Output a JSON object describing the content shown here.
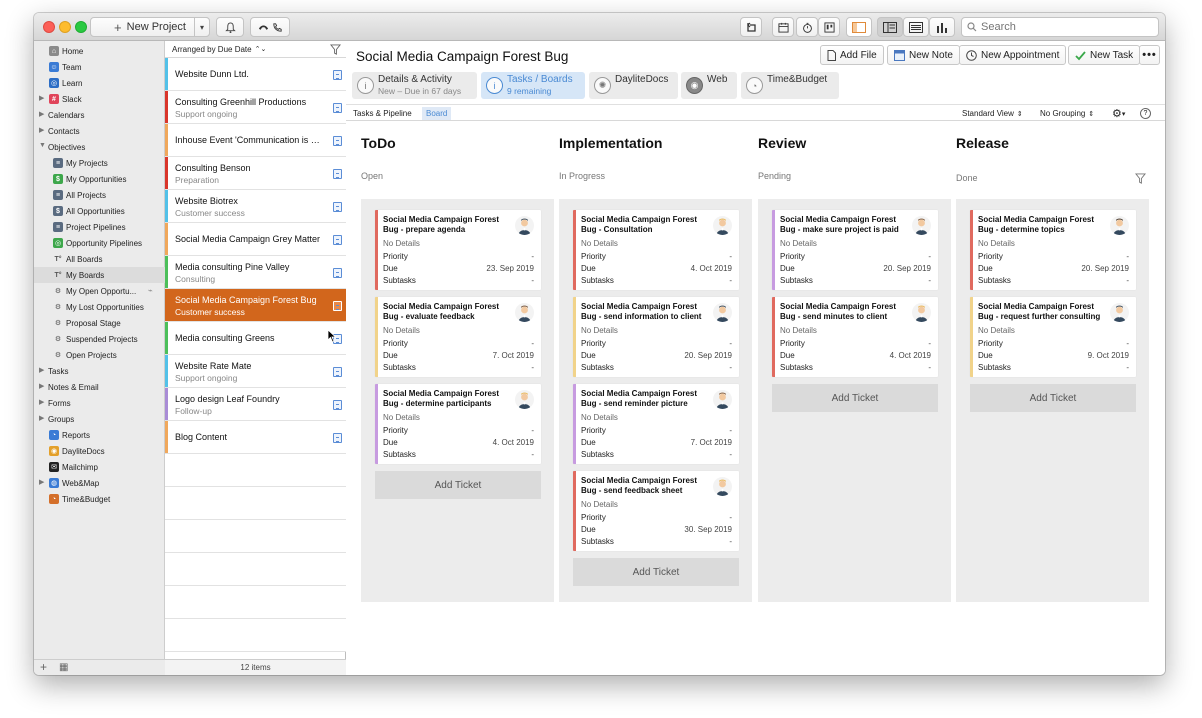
{
  "toolbar": {
    "new_project": "New Project",
    "search_placeholder": "Search"
  },
  "sidebar": {
    "items": [
      {
        "label": "Home"
      },
      {
        "label": "Team"
      },
      {
        "label": "Learn"
      },
      {
        "label": "Slack"
      },
      {
        "label": "Calendars"
      },
      {
        "label": "Contacts"
      },
      {
        "label": "Objectives"
      },
      {
        "label": "My Projects"
      },
      {
        "label": "My Opportunities"
      },
      {
        "label": "All Projects"
      },
      {
        "label": "All Opportunities"
      },
      {
        "label": "Project Pipelines"
      },
      {
        "label": "Opportunity Pipelines"
      },
      {
        "label": "All Boards"
      },
      {
        "label": "My Boards"
      },
      {
        "label": "My Open Opportu..."
      },
      {
        "label": "My Lost Opportunities"
      },
      {
        "label": "Proposal Stage"
      },
      {
        "label": "Suspended Projects"
      },
      {
        "label": "Open Projects"
      },
      {
        "label": "Tasks"
      },
      {
        "label": "Notes & Email"
      },
      {
        "label": "Forms"
      },
      {
        "label": "Groups"
      },
      {
        "label": "Reports"
      },
      {
        "label": "DayliteDocs"
      },
      {
        "label": "Mailchimp"
      },
      {
        "label": "Web&Map"
      },
      {
        "label": "Time&Budget"
      }
    ]
  },
  "list": {
    "header": "Arranged by Due Date",
    "footer": "12 items",
    "rows": [
      {
        "title": "Website Dunn Ltd.",
        "subtitle": "",
        "color": "#53c1e8"
      },
      {
        "title": "Consulting Greenhill Productions",
        "subtitle": "Support ongoing",
        "color": "#d9362b"
      },
      {
        "title": "Inhouse Event 'Communication is e...",
        "subtitle": "",
        "color": "#f0a85c"
      },
      {
        "title": "Consulting Benson",
        "subtitle": "Preparation",
        "color": "#d9362b"
      },
      {
        "title": "Website Biotrex",
        "subtitle": "Customer success",
        "color": "#53c1e8"
      },
      {
        "title": "Social Media Campaign Grey Matter",
        "subtitle": "",
        "color": "#f0a85c"
      },
      {
        "title": "Media consulting Pine Valley",
        "subtitle": "Consulting",
        "color": "#4cbf5a"
      },
      {
        "title": "Social Media Campaign Forest Bug",
        "subtitle": "Customer success",
        "color": "#d2661c"
      },
      {
        "title": "Media consulting Greens",
        "subtitle": "",
        "color": "#4cbf5a"
      },
      {
        "title": "Website Rate Mate",
        "subtitle": "Support ongoing",
        "color": "#53c1e8"
      },
      {
        "title": "Logo design Leaf Foundry",
        "subtitle": "Follow-up",
        "color": "#a98cd6"
      },
      {
        "title": "Blog Content",
        "subtitle": "",
        "color": "#f0a85c"
      }
    ]
  },
  "main": {
    "title": "Social Media Campaign Forest Bug",
    "actions": {
      "add_file": "Add File",
      "new_note": "New Note",
      "new_appointment": "New Appointment",
      "new_task": "New Task"
    },
    "tabs": [
      {
        "label": "Details & Activity",
        "sub": "New – Due in 67 days"
      },
      {
        "label": "Tasks / Boards",
        "sub": "9 remaining"
      },
      {
        "label": "DayliteDocs",
        "sub": ""
      },
      {
        "label": "Web",
        "sub": ""
      },
      {
        "label": "Time&Budget",
        "sub": ""
      }
    ],
    "subtabs": {
      "pipeline": "Tasks & Pipeline",
      "board": "Board"
    },
    "view": "Standard View",
    "grouping": "No Grouping",
    "help": "?"
  },
  "board": {
    "labels": {
      "no_details": "No Details",
      "priority": "Priority",
      "due": "Due",
      "subtasks": "Subtasks",
      "dash": "-",
      "add_ticket": "Add Ticket"
    },
    "columns": [
      {
        "title": "ToDo",
        "status": "Open",
        "cards": [
          {
            "title": "Social Media Campaign Forest Bug - prepare agenda",
            "due": "23. Sep 2019",
            "color": "#e06a5f"
          },
          {
            "title": "Social Media Campaign Forest Bug - evaluate feedback",
            "due": "7. Oct 2019",
            "color": "#f1d38a"
          },
          {
            "title": "Social Media Campaign Forest Bug - determine participants",
            "due": "4. Oct 2019",
            "color": "#c79be0"
          }
        ]
      },
      {
        "title": "Implementation",
        "status": "In Progress",
        "cards": [
          {
            "title": "Social Media Campaign Forest Bug - Consultation",
            "due": "4. Oct 2019",
            "color": "#e06a5f"
          },
          {
            "title": "Social Media Campaign Forest Bug - send information to client",
            "due": "20. Sep 2019",
            "color": "#f1d38a"
          },
          {
            "title": "Social Media Campaign Forest Bug - send reminder picture",
            "due": "7. Oct 2019",
            "color": "#c79be0"
          },
          {
            "title": "Social Media Campaign Forest Bug - send feedback sheet",
            "due": "30. Sep 2019",
            "color": "#e06a5f"
          }
        ]
      },
      {
        "title": "Review",
        "status": "Pending",
        "cards": [
          {
            "title": "Social Media Campaign Forest Bug - make sure project is paid",
            "due": "20. Sep 2019",
            "color": "#c79be0"
          },
          {
            "title": "Social Media Campaign Forest Bug - send minutes to client",
            "due": "4. Oct 2019",
            "color": "#e06a5f"
          }
        ]
      },
      {
        "title": "Release",
        "status": "Done",
        "cards": [
          {
            "title": "Social Media Campaign Forest Bug - determine topics",
            "due": "20. Sep 2019",
            "color": "#e06a5f"
          },
          {
            "title": "Social Media Campaign Forest Bug - request further consulting",
            "due": "9. Oct 2019",
            "color": "#f1d38a"
          }
        ]
      }
    ]
  }
}
